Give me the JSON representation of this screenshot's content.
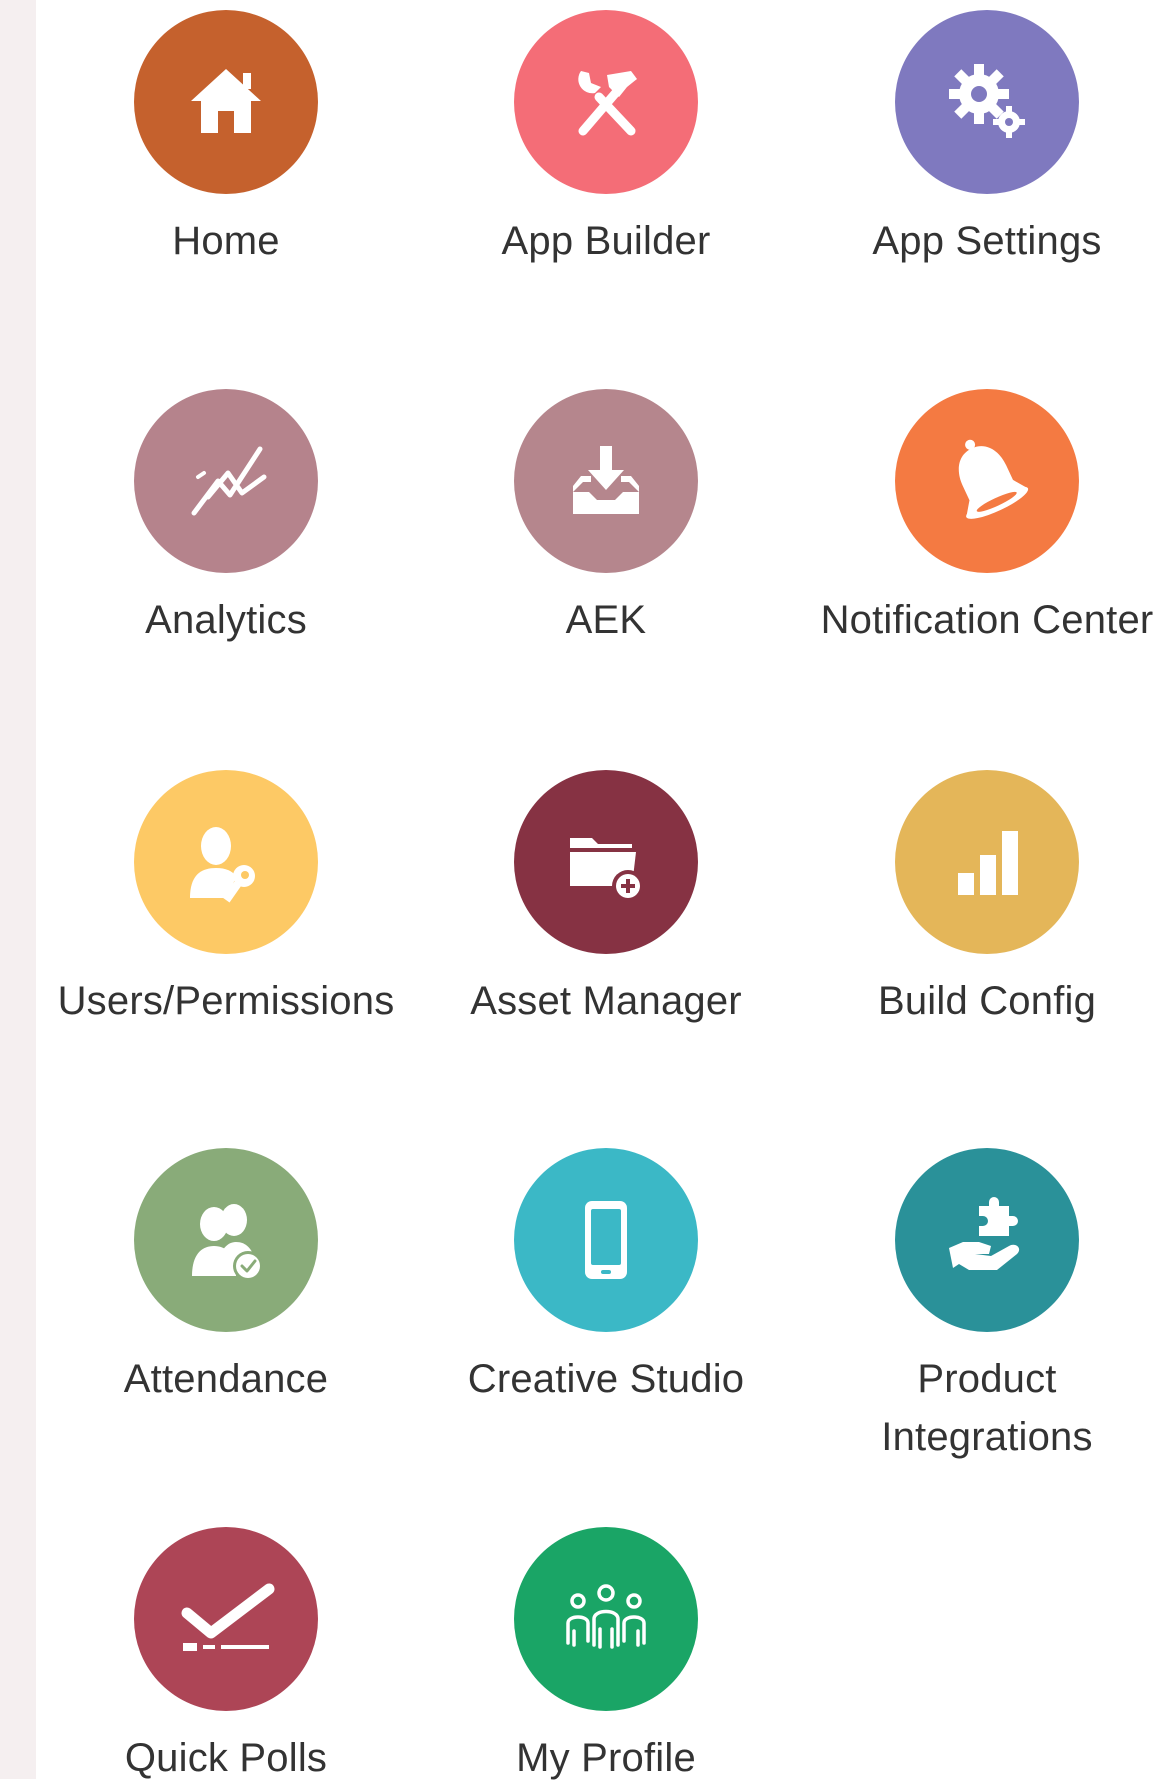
{
  "apps": [
    {
      "label": "Home",
      "icon": "home-icon",
      "color": "#c5612d"
    },
    {
      "label": "App Builder",
      "icon": "hammer-wrench-icon",
      "color": "#f46d77"
    },
    {
      "label": "App Settings",
      "icon": "gears-icon",
      "color": "#7f79bf"
    },
    {
      "label": "Analytics",
      "icon": "trend-lines-icon",
      "color": "#b5838c"
    },
    {
      "label": "AEK",
      "icon": "download-tray-icon",
      "color": "#b5868d"
    },
    {
      "label": "Notification Center",
      "icon": "bell-icon",
      "color": "#f47a42"
    },
    {
      "label": "Users/Permissions",
      "icon": "user-key-icon",
      "color": "#fdc965"
    },
    {
      "label": "Asset Manager",
      "icon": "folder-plus-icon",
      "color": "#863243"
    },
    {
      "label": "Build Config",
      "icon": "bar-signal-icon",
      "color": "#e4b659"
    },
    {
      "label": "Attendance",
      "icon": "users-check-icon",
      "color": "#89ab79"
    },
    {
      "label": "Creative Studio",
      "icon": "smartphone-icon",
      "color": "#3bb8c6"
    },
    {
      "label": "Product\nIntegrations",
      "icon": "hand-puzzle-icon",
      "color": "#2a9199"
    },
    {
      "label": "Quick Polls",
      "icon": "poll-check-icon",
      "color": "#ad4556"
    },
    {
      "label": "My Profile",
      "icon": "people-group-icon",
      "color": "#1aa566"
    }
  ]
}
